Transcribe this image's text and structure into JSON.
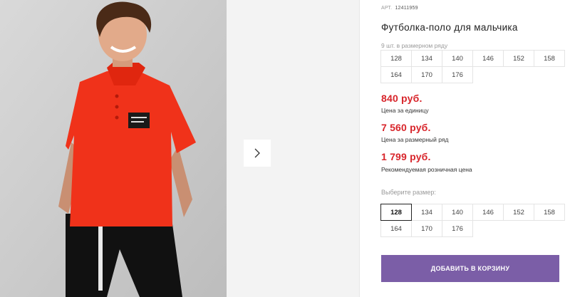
{
  "product": {
    "art_label": "АРТ.",
    "art_number": "12411959",
    "title": "Футболка-поло для мальчика"
  },
  "size_pack": {
    "label": "9 шт. в размерном ряду",
    "sizes": [
      "128",
      "134",
      "140",
      "146",
      "152",
      "158",
      "164",
      "170",
      "176"
    ]
  },
  "prices": [
    {
      "value": "840 руб.",
      "note": "Цена за единицу"
    },
    {
      "value": "7 560 руб.",
      "note": "Цена за размерный ряд"
    },
    {
      "value": "1 799 руб.",
      "note": "Рекомендуемая розничная цена"
    }
  ],
  "size_select": {
    "label": "Выберите размер:",
    "options": [
      "128",
      "134",
      "140",
      "146",
      "152",
      "158",
      "164",
      "170",
      "176"
    ],
    "selected": "128"
  },
  "cart_button": {
    "label": "ДОБАВИТЬ В КОРЗИНУ"
  },
  "gallery": {
    "next_icon": "chevron-right-icon"
  },
  "colors": {
    "price": "#d8252b",
    "button": "#7b5ea7",
    "shirt": "#f0321a",
    "pants": "#111111"
  }
}
